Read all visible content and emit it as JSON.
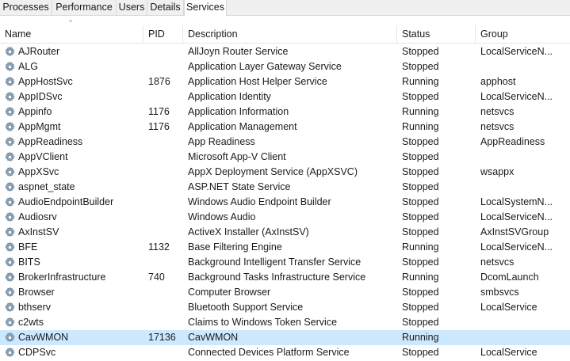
{
  "tabs": [
    {
      "label": "Processes"
    },
    {
      "label": "Performance"
    },
    {
      "label": "Users"
    },
    {
      "label": "Details"
    },
    {
      "label": "Services"
    }
  ],
  "columns": {
    "name": "Name",
    "pid": "PID",
    "description": "Description",
    "status": "Status",
    "group": "Group"
  },
  "sort_indicator": "^",
  "icon": "gear-icon",
  "selected_color": "#cce8ff",
  "services": [
    {
      "name": "AJRouter",
      "pid": "",
      "description": "AllJoyn Router Service",
      "status": "Stopped",
      "group": "LocalServiceN..."
    },
    {
      "name": "ALG",
      "pid": "",
      "description": "Application Layer Gateway Service",
      "status": "Stopped",
      "group": ""
    },
    {
      "name": "AppHostSvc",
      "pid": "1876",
      "description": "Application Host Helper Service",
      "status": "Running",
      "group": "apphost"
    },
    {
      "name": "AppIDSvc",
      "pid": "",
      "description": "Application Identity",
      "status": "Stopped",
      "group": "LocalServiceN..."
    },
    {
      "name": "Appinfo",
      "pid": "1176",
      "description": "Application Information",
      "status": "Running",
      "group": "netsvcs"
    },
    {
      "name": "AppMgmt",
      "pid": "1176",
      "description": "Application Management",
      "status": "Running",
      "group": "netsvcs"
    },
    {
      "name": "AppReadiness",
      "pid": "",
      "description": "App Readiness",
      "status": "Stopped",
      "group": "AppReadiness"
    },
    {
      "name": "AppVClient",
      "pid": "",
      "description": "Microsoft App-V Client",
      "status": "Stopped",
      "group": ""
    },
    {
      "name": "AppXSvc",
      "pid": "",
      "description": "AppX Deployment Service (AppXSVC)",
      "status": "Stopped",
      "group": "wsappx"
    },
    {
      "name": "aspnet_state",
      "pid": "",
      "description": "ASP.NET State Service",
      "status": "Stopped",
      "group": ""
    },
    {
      "name": "AudioEndpointBuilder",
      "pid": "",
      "description": "Windows Audio Endpoint Builder",
      "status": "Stopped",
      "group": "LocalSystemN..."
    },
    {
      "name": "Audiosrv",
      "pid": "",
      "description": "Windows Audio",
      "status": "Stopped",
      "group": "LocalServiceN..."
    },
    {
      "name": "AxInstSV",
      "pid": "",
      "description": "ActiveX Installer (AxInstSV)",
      "status": "Stopped",
      "group": "AxInstSVGroup"
    },
    {
      "name": "BFE",
      "pid": "1132",
      "description": "Base Filtering Engine",
      "status": "Running",
      "group": "LocalServiceN..."
    },
    {
      "name": "BITS",
      "pid": "",
      "description": "Background Intelligent Transfer Service",
      "status": "Stopped",
      "group": "netsvcs"
    },
    {
      "name": "BrokerInfrastructure",
      "pid": "740",
      "description": "Background Tasks Infrastructure Service",
      "status": "Running",
      "group": "DcomLaunch"
    },
    {
      "name": "Browser",
      "pid": "",
      "description": "Computer Browser",
      "status": "Stopped",
      "group": "smbsvcs"
    },
    {
      "name": "bthserv",
      "pid": "",
      "description": "Bluetooth Support Service",
      "status": "Stopped",
      "group": "LocalService"
    },
    {
      "name": "c2wts",
      "pid": "",
      "description": "Claims to Windows Token Service",
      "status": "Stopped",
      "group": ""
    },
    {
      "name": "CavWMON",
      "pid": "17136",
      "description": "CavWMON",
      "status": "Running",
      "group": "",
      "selected": true
    },
    {
      "name": "CDPSvc",
      "pid": "",
      "description": "Connected Devices Platform Service",
      "status": "Stopped",
      "group": "LocalService"
    }
  ]
}
